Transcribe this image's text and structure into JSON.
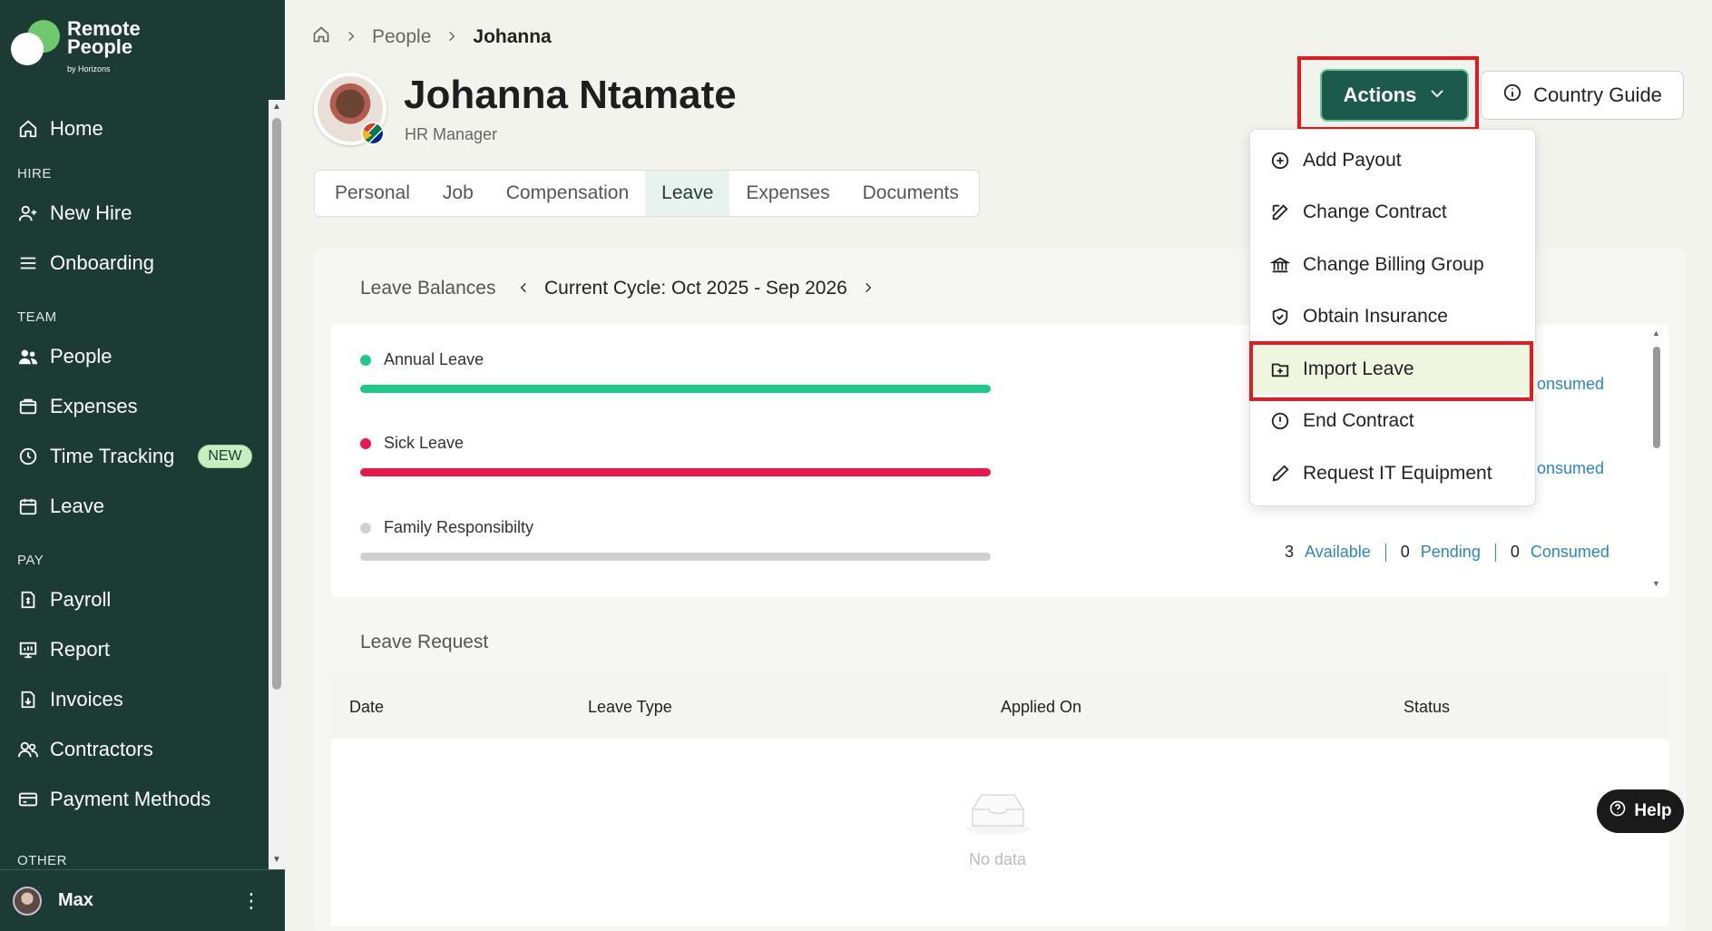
{
  "brand": {
    "line1": "Remote",
    "line2": "People",
    "sub": "by Horizons"
  },
  "sidebar": {
    "items": [
      {
        "type": "item",
        "label": "Home",
        "icon": "home-icon"
      },
      {
        "type": "section",
        "label": "HIRE"
      },
      {
        "type": "item",
        "label": "New Hire",
        "icon": "user-plus-icon"
      },
      {
        "type": "item",
        "label": "Onboarding",
        "icon": "list-icon"
      },
      {
        "type": "section",
        "label": "TEAM"
      },
      {
        "type": "item",
        "label": "People",
        "icon": "people-icon"
      },
      {
        "type": "item",
        "label": "Expenses",
        "icon": "wallet-icon"
      },
      {
        "type": "item",
        "label": "Time Tracking",
        "icon": "clock-icon",
        "badge": "NEW"
      },
      {
        "type": "item",
        "label": "Leave",
        "icon": "calendar-icon"
      },
      {
        "type": "section",
        "label": "PAY"
      },
      {
        "type": "item",
        "label": "Payroll",
        "icon": "payroll-icon"
      },
      {
        "type": "item",
        "label": "Report",
        "icon": "report-icon"
      },
      {
        "type": "item",
        "label": "Invoices",
        "icon": "invoice-icon"
      },
      {
        "type": "item",
        "label": "Contractors",
        "icon": "contractors-icon"
      },
      {
        "type": "item",
        "label": "Payment Methods",
        "icon": "card-icon"
      },
      {
        "type": "section",
        "label": "OTHER"
      }
    ]
  },
  "user": {
    "name": "Max"
  },
  "breadcrumb": {
    "parent": "People",
    "current": "Johanna"
  },
  "profile": {
    "name": "Johanna Ntamate",
    "role": "HR Manager"
  },
  "tabs": [
    {
      "label": "Personal",
      "active": false
    },
    {
      "label": "Job",
      "active": false
    },
    {
      "label": "Compensation",
      "active": false
    },
    {
      "label": "Leave",
      "active": true
    },
    {
      "label": "Expenses",
      "active": false
    },
    {
      "label": "Documents",
      "active": false
    }
  ],
  "header": {
    "actions_label": "Actions",
    "country_guide_label": "Country Guide"
  },
  "actions_menu": [
    {
      "label": "Add Payout",
      "icon": "plus-circle-icon"
    },
    {
      "label": "Change Contract",
      "icon": "edit-icon"
    },
    {
      "label": "Change Billing Group",
      "icon": "bank-icon"
    },
    {
      "label": "Obtain Insurance",
      "icon": "shield-icon"
    },
    {
      "label": "Import Leave",
      "icon": "import-icon",
      "highlighted": true
    },
    {
      "label": "End Contract",
      "icon": "alert-circle-icon"
    },
    {
      "label": "Request IT Equipment",
      "icon": "pencil-icon"
    }
  ],
  "leave_balances": {
    "title": "Leave Balances",
    "cycle": "Current Cycle: Oct 2025 - Sep 2026",
    "items": [
      {
        "name": "Annual Leave",
        "color": "#1ecb86",
        "partial": "onsumed"
      },
      {
        "name": "Sick Leave",
        "color": "#e8194a",
        "partial": "onsumed"
      },
      {
        "name": "Family Responsibilty",
        "color": "#d0d0d0",
        "available": "3",
        "pending": "0",
        "consumed": "0",
        "available_label": "Available",
        "pending_label": "Pending",
        "consumed_label": "Consumed"
      }
    ]
  },
  "leave_request": {
    "title": "Leave Request",
    "columns": [
      "Date",
      "Leave Type",
      "Applied On",
      "Status"
    ],
    "empty_text": "No data"
  },
  "help": {
    "label": "Help"
  },
  "colors": {
    "sidebar_bg": "#1c3b34",
    "accent": "#1c5b4c",
    "highlight": "#e01b22"
  }
}
